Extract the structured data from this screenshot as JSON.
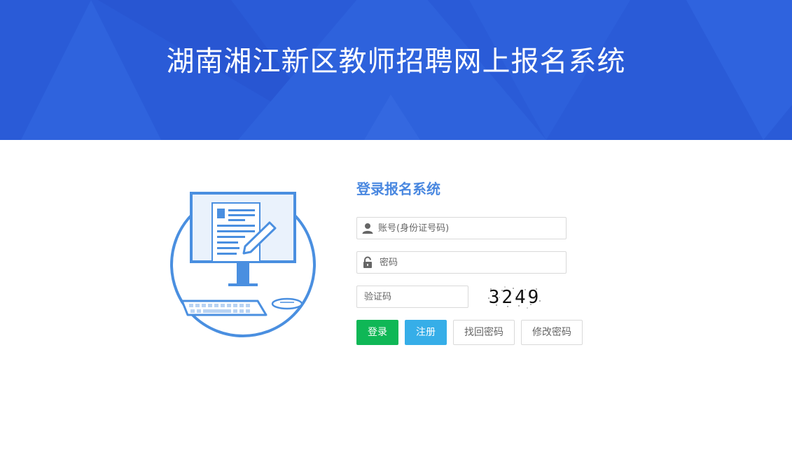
{
  "header": {
    "title": "湖南湘江新区教师招聘网上报名系统",
    "background_color": "#2a5bd7"
  },
  "login": {
    "title": "登录报名系统",
    "username_placeholder": "账号(身份证号码)",
    "password_placeholder": "密码",
    "captcha_placeholder": "验证码",
    "captcha_code": "3249",
    "buttons": {
      "login": "登录",
      "register": "注册",
      "find_password": "找回密码",
      "modify_password": "修改密码"
    }
  },
  "icons": {
    "user": "user-icon",
    "lock": "lock-icon"
  },
  "colors": {
    "accent": "#4a88e0",
    "login_button": "#0fb756",
    "register_button": "#36aee8"
  }
}
